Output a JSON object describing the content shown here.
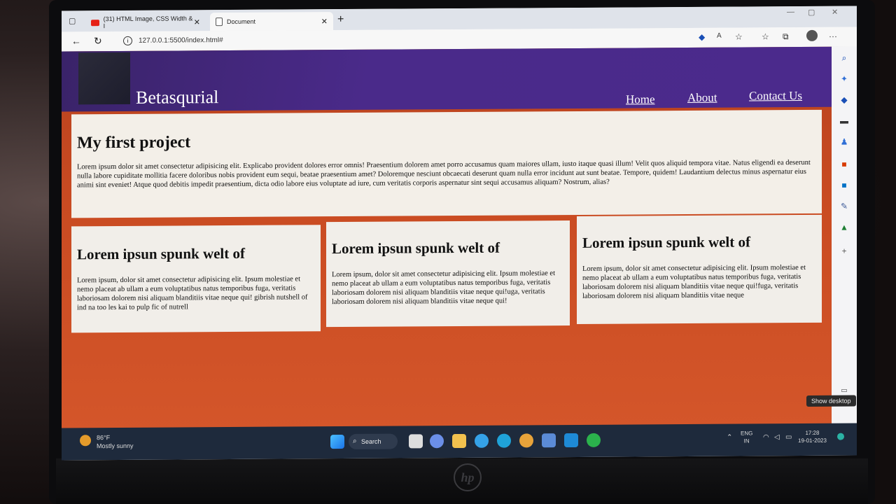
{
  "browser": {
    "tabs": [
      {
        "label": "(31) HTML Image, CSS Width & I",
        "favicon_color": "#e62117"
      },
      {
        "label": "Document"
      }
    ],
    "url": "127.0.0.1:5500/index.html#",
    "new_tab": "+"
  },
  "site": {
    "brand": "Betasqurial",
    "nav": [
      "Home",
      "About",
      "Contact Us"
    ],
    "hero": {
      "title": "My first project",
      "body": "Lorem ipsum dolor sit amet consectetur adipisicing elit. Explicabo provident dolores error omnis! Praesentium dolorem amet porro accusamus quam maiores ullam, iusto itaque quasi illum! Velit quos aliquid tempora vitae. Natus eligendi ea deserunt nulla labore cupiditate mollitia facere doloribus nobis provident eum sequi, beatae praesentium amet? Doloremque nesciunt obcaecati deserunt quam nulla error incidunt aut sunt beatae. Tempore, quidem! Laudantium delectus minus aspernatur eius animi sint eveniet! Atque quod debitis impedit praesentium, dicta odio labore eius voluptate ad iure, cum veritatis corporis aspernatur sint sequi accusamus aliquam? Nostrum, alias?"
    },
    "cards": [
      {
        "title": "Lorem ipsun spunk welt of",
        "body": "Lorem ipsum, dolor sit amet consectetur adipisicing elit. Ipsum molestiae et nemo placeat ab ullam a eum voluptatibus natus temporibus fuga, veritatis laboriosam dolorem nisi aliquam blanditiis vitae neque qui! gibrish nutshell of ind na too les kai to pulp fic of nutrell"
      },
      {
        "title": "Lorem ipsun spunk welt of",
        "body": "Lorem ipsum, dolor sit amet consectetur adipisicing elit. Ipsum molestiae et nemo placeat ab ullam a eum voluptatibus natus temporibus fuga, veritatis laboriosam dolorem nisi aliquam blanditiis vitae neque qui!uga, veritatis laboriosam dolorem nisi aliquam blanditiis vitae neque qui!"
      },
      {
        "title": "Lorem ipsun spunk welt of",
        "body": "Lorem ipsum, dolor sit amet consectetur adipisicing elit. Ipsum molestiae et nemo placeat ab ullam a eum voluptatibus natus temporibus fuga, veritatis laboriosam dolorem nisi aliquam blanditiis vitae neque qui!fuga, veritatis laboriosam dolorem nisi aliquam blanditiis vitae neque"
      }
    ],
    "colors": {
      "header": "#4a2a8a",
      "background": "#c94b22",
      "panel": "#f3efe8"
    }
  },
  "os": {
    "show_desktop": "Show desktop",
    "weather": {
      "temp": "86°F",
      "desc": "Mostly sunny"
    },
    "search": "Search",
    "lang": "ENG",
    "region": "IN",
    "time": "17:28",
    "date": "19-01-2023"
  },
  "laptop_brand": "hp"
}
